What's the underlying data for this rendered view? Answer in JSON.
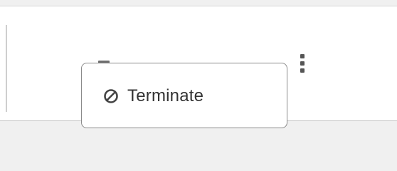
{
  "actions_menu": {
    "items": [
      {
        "label": "Terminate",
        "icon": "block-icon"
      }
    ]
  },
  "colors": {
    "panel_background": "#ffffff",
    "page_background": "#f0f0f0",
    "menu_border": "#8a8a8a",
    "text": "#333333",
    "icon": "#555555"
  }
}
